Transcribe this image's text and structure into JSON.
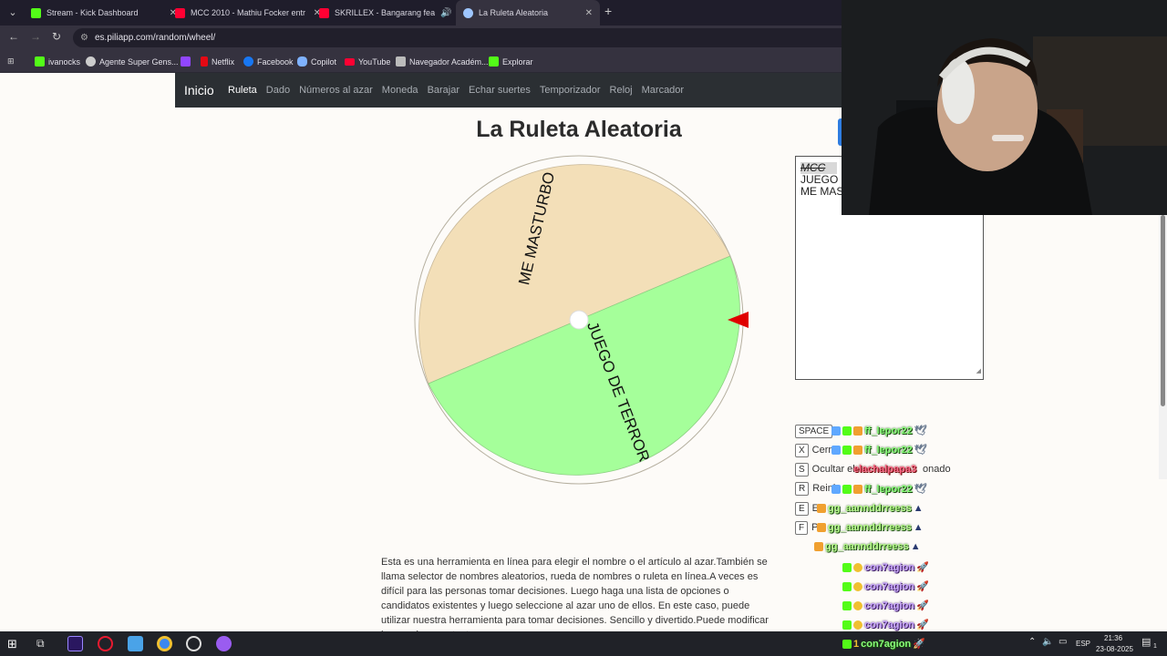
{
  "browser": {
    "tabs": [
      {
        "title": "Stream - Kick Dashboard",
        "icon": "kick-icon",
        "color": "#53fc18"
      },
      {
        "title": "MCC 2010 - Mathiu Focker entr",
        "icon": "youtube-icon",
        "color": "#ff0033"
      },
      {
        "title": "SKRILLEX - Bangarang feat.",
        "icon": "youtube-icon",
        "color": "#ff0033"
      },
      {
        "title": "La Ruleta Aleatoria",
        "icon": "piliapp-icon",
        "color": "#9ec6ff"
      }
    ],
    "url": "es.piliapp.com/random/wheel/",
    "bookmarks": [
      {
        "label": "ivanocks",
        "color": "#53fc18"
      },
      {
        "label": "Agente Super Gens...",
        "color": "#cccccc"
      },
      {
        "label": "",
        "color": "#9146ff"
      },
      {
        "label": "Netflix",
        "color": "#e50914"
      },
      {
        "label": "Facebook",
        "color": "#1877f2"
      },
      {
        "label": "Copilot",
        "color": "#7fb2ff"
      },
      {
        "label": "YouTube",
        "color": "#ff0033"
      },
      {
        "label": "Navegador Académ...",
        "color": "#bbbbbb"
      },
      {
        "label": "Explorar",
        "color": "#53fc18"
      }
    ]
  },
  "site": {
    "brand": "Inicio",
    "nav": [
      "Ruleta",
      "Dado",
      "Números al azar",
      "Moneda",
      "Barajar",
      "Echar suertes",
      "Temporizador",
      "Reloj",
      "Marcador"
    ],
    "active_nav": "Ruleta",
    "title": "La Ruleta Aleatoria"
  },
  "wheel": {
    "segments": [
      {
        "label": "ME MASTURBO",
        "color": "#f3dfb8"
      },
      {
        "label": "JUEGO DE TERROR",
        "color": "#a5ff9a"
      }
    ],
    "pointer_color": "#e00000"
  },
  "listbox": {
    "lines": [
      "MCC",
      "JUEGO D",
      "ME MAS"
    ]
  },
  "shortcuts": [
    {
      "key": "SPACE",
      "label": ""
    },
    {
      "key": "X",
      "label": "Cerra"
    },
    {
      "key": "S",
      "label": "Ocultar el"
    },
    {
      "key": "R",
      "label": "Reinic"
    },
    {
      "key": "E",
      "label": "E"
    },
    {
      "key": "F",
      "label": "P"
    }
  ],
  "shortcut_tail": "onado",
  "chat": [
    {
      "name": "ff_lepor22",
      "style": "g"
    },
    {
      "name": "ff_lepor22",
      "style": "g"
    },
    {
      "name": "elachalpapa3",
      "style": "r"
    },
    {
      "name": "ff_lepor22",
      "style": "g"
    },
    {
      "name": "gg_aannddrreess",
      "style": "g2"
    },
    {
      "name": "gg_aannddrreess",
      "style": "g2"
    },
    {
      "name": "gg_aannddrreess",
      "style": "g2"
    },
    {
      "name": "con7agion",
      "style": "p"
    },
    {
      "name": "con7agion",
      "style": "p"
    },
    {
      "name": "con7agion",
      "style": "p"
    },
    {
      "name": "con7agion",
      "style": "p"
    }
  ],
  "overlay_bottom": {
    "count": "1",
    "name": "con7agion"
  },
  "description": "Esta es una herramienta en línea para elegir el nombre o el artículo al azar.También se llama selector de nombres aleatorios, rueda de nombres o ruleta en línea.A veces es difícil para las personas tomar decisiones. Luego haga una lista de opciones o candidatos existentes y luego seleccione al azar uno de ellos. En este caso, puede utilizar nuestra herramienta para tomar decisiones. Sencillo y divertido.Puede modificar los nombres en textarea, poner un",
  "taskbar": {
    "lang": "ESP",
    "time": "21:36",
    "date": "23-08-2025",
    "notif_count": "1"
  }
}
